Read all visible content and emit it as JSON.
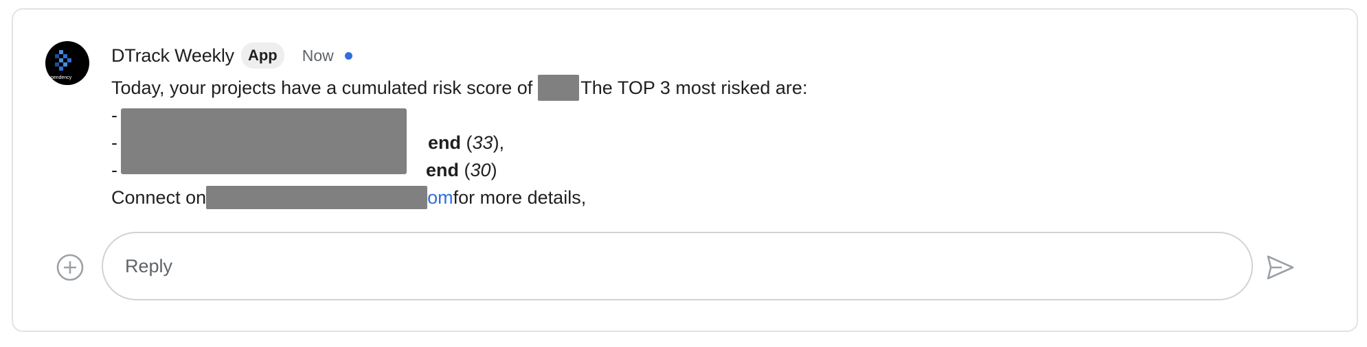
{
  "message": {
    "sender": "DTrack Weekly",
    "badge": "App",
    "time": "Now",
    "avatar_icon": "dependency-track-logo",
    "avatar_caption": "ependency",
    "intro_before": "Today, your projects have a cumulated risk score of ",
    "intro_after": "The TOP 3 most risked are:",
    "items": [
      {
        "bullet": "- ",
        "suffix_bold": "",
        "score": "",
        "trail": ""
      },
      {
        "bullet": "- ",
        "suffix_bold": "end",
        "score": "33",
        "trail": "),"
      },
      {
        "bullet": "- ",
        "suffix_bold": "end",
        "score": "30",
        "trail": ")"
      }
    ],
    "connect_prefix": "Connect on ",
    "link_tail": "om",
    "connect_suffix": " for more details,"
  },
  "reply": {
    "placeholder": "Reply",
    "add_icon": "plus-circle-icon",
    "send_icon": "send-icon"
  },
  "colors": {
    "accent": "#2f6fdc",
    "redaction": "#808080",
    "border": "#e3e3e3"
  }
}
